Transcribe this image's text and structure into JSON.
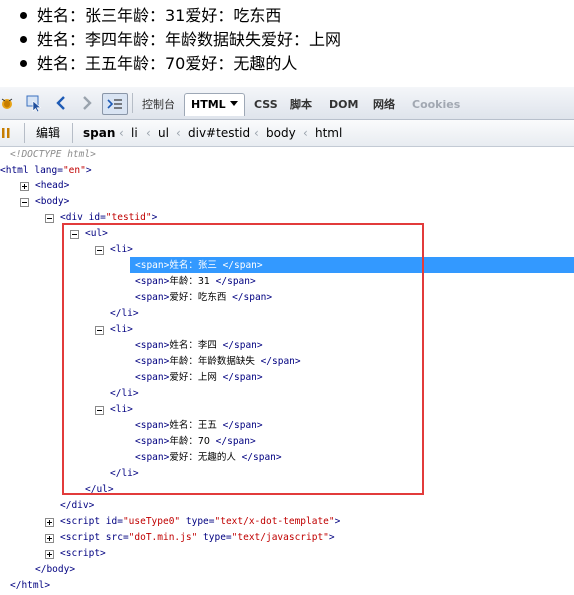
{
  "page_list": [
    "姓名：张三年龄：31爱好：吃东西",
    "姓名：李四年龄：年龄数据缺失爱好：上网",
    "姓名：王五年龄：70爱好：无趣的人"
  ],
  "toolbar": {
    "tabs": [
      "控制台",
      "HTML",
      "CSS",
      "脚本",
      "DOM",
      "网络",
      "Cookies"
    ],
    "edit_label": "编辑",
    "breadcrumb": [
      "span",
      "li",
      "ul",
      "div#testid",
      "body",
      "html"
    ]
  },
  "tree": {
    "doctype": "<!DOCTYPE html>",
    "html_open": "<html",
    "html_attr_name": "lang=",
    "html_attr_value": "\"en\"",
    "html_close_bracket": ">",
    "head": "<head>",
    "body_open": "<body>",
    "div_open": "<div",
    "div_attr_name": "id=",
    "div_attr_value": "\"testid\"",
    "div_close_bracket": ">",
    "ul_open": "<ul>",
    "li_open": "<li>",
    "li_close": "</li>",
    "ul_close": "</ul>",
    "div_close": "</div>",
    "span_open": "<span>",
    "span_close": "</span>",
    "items": [
      {
        "name": "姓名：张三",
        "age": "年龄：31",
        "hobby": "爱好：吃东西"
      },
      {
        "name": "姓名：李四",
        "age": "年龄：年龄数据缺失",
        "hobby": "爱好：上网"
      },
      {
        "name": "姓名：王五",
        "age": "年龄：70",
        "hobby": "爱好：无趣的人"
      }
    ],
    "script1_attrs": [
      {
        "name": "id=",
        "value": "\"useType0\""
      },
      {
        "name": "type=",
        "value": "\"text/x-dot-template\""
      }
    ],
    "script2_attrs": [
      {
        "name": "src=",
        "value": "\"doT.min.js\""
      },
      {
        "name": "type=",
        "value": "\"text/javascript\""
      }
    ],
    "script_open": "<script",
    "script_bare": "<script>",
    "close_bracket": ">",
    "body_close": "</body>",
    "html_close": "</html>"
  }
}
